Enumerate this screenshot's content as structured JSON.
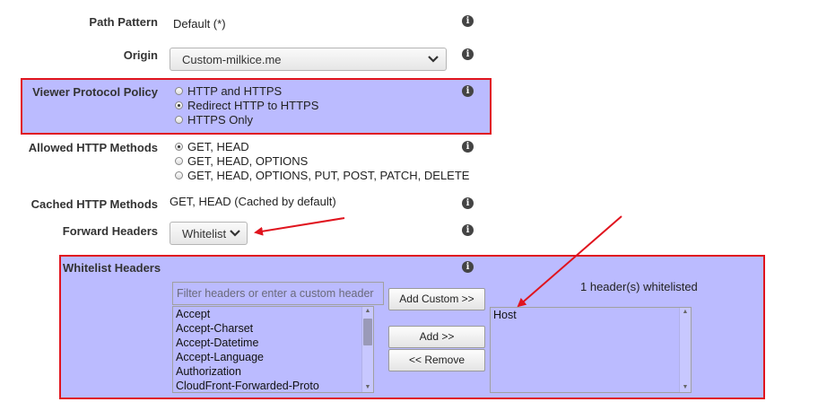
{
  "path_pattern": {
    "label": "Path Pattern",
    "value": "Default (*)"
  },
  "origin": {
    "label": "Origin",
    "selected": "Custom-milkice.me"
  },
  "viewer_protocol_policy": {
    "label": "Viewer Protocol Policy",
    "options": [
      {
        "text": "HTTP and HTTPS",
        "checked": false
      },
      {
        "text": "Redirect HTTP to HTTPS",
        "checked": true
      },
      {
        "text": "HTTPS Only",
        "checked": false
      }
    ]
  },
  "allowed_http_methods": {
    "label": "Allowed HTTP Methods",
    "options": [
      {
        "text": "GET, HEAD",
        "checked": true
      },
      {
        "text": "GET, HEAD, OPTIONS",
        "checked": false
      },
      {
        "text": "GET, HEAD, OPTIONS, PUT, POST, PATCH, DELETE",
        "checked": false
      }
    ]
  },
  "cached_http_methods": {
    "label": "Cached HTTP Methods",
    "value": "GET, HEAD (Cached by default)"
  },
  "forward_headers": {
    "label": "Forward Headers",
    "selected": "Whitelist"
  },
  "whitelist_headers": {
    "label": "Whitelist Headers",
    "filter_placeholder": "Filter headers or enter a custom header",
    "add_custom_label": "Add Custom >>",
    "add_label": "Add >>",
    "remove_label": "<< Remove",
    "whitelisted_count": "1 header(s) whitelisted",
    "available": [
      "Accept",
      "Accept-Charset",
      "Accept-Datetime",
      "Accept-Language",
      "Authorization",
      "CloudFront-Forwarded-Proto"
    ],
    "selected": [
      "Host"
    ]
  },
  "colors": {
    "highlight_border": "#e0141e",
    "highlight_fill": "#bbbbff",
    "annotation_arrow": "#e0141e"
  },
  "icons": {
    "info": "info-icon",
    "dropdown": "chevron-down-icon"
  }
}
